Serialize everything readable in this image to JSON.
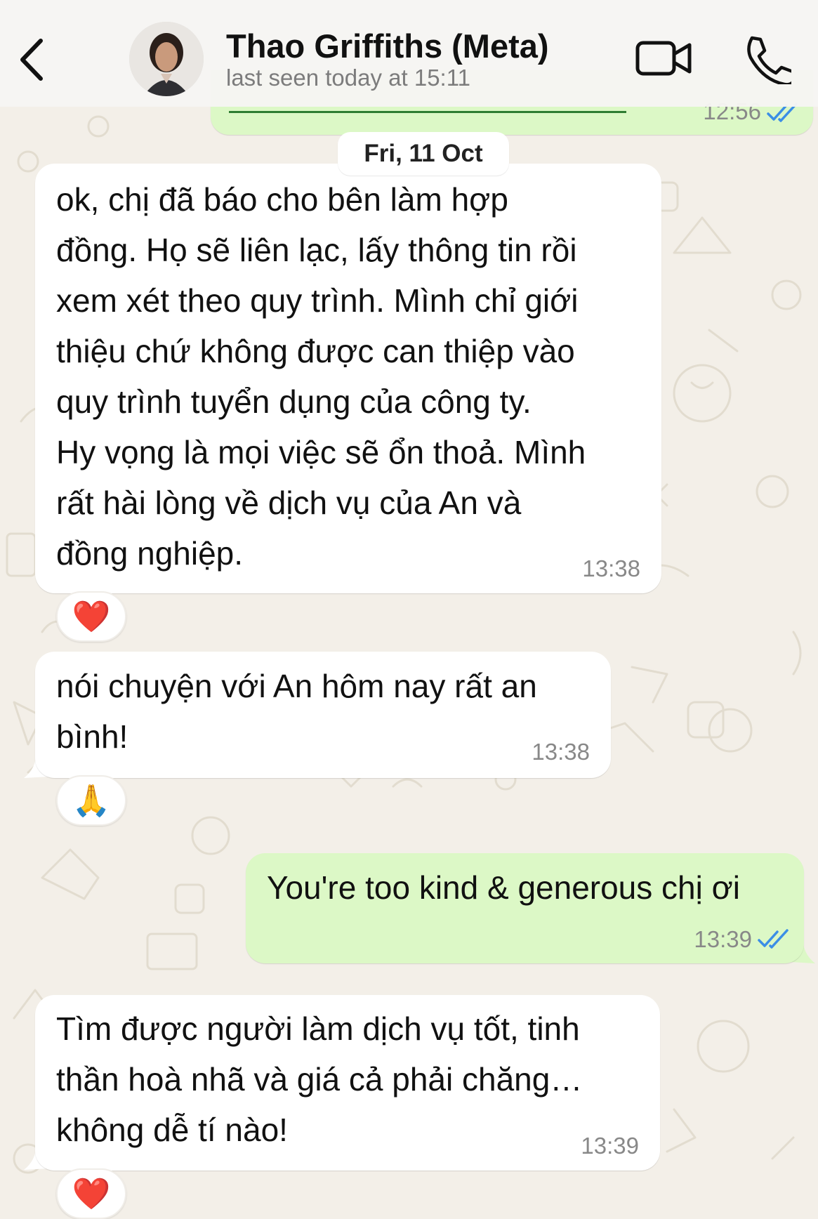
{
  "contact": {
    "name": "Thao Griffiths (Meta)",
    "status": "last seen today at 15:11"
  },
  "previous_message": {
    "time": "12:56"
  },
  "date_separator": "Fri, 11 Oct",
  "messages": [
    {
      "direction": "incoming",
      "lines": [
        "ok, chị đã báo cho bên làm hợp",
        "đồng. Họ sẽ liên lạc, lấy thông tin rồi",
        "xem xét theo quy trình. Mình chỉ giới",
        "thiệu chứ không được can thiệp vào",
        "quy trình tuyển dụng của công ty.",
        "Hy vọng là mọi việc sẽ ổn thoả. Mình",
        "rất hài lòng về dịch vụ của An và",
        "đồng nghiệp."
      ],
      "time": "13:38",
      "reaction": "❤️"
    },
    {
      "direction": "incoming",
      "lines": [
        "nói chuyện với An hôm nay rất an",
        "bình!"
      ],
      "time": "13:38",
      "reaction": "🙏"
    },
    {
      "direction": "outgoing",
      "lines": [
        "You're too kind & generous chị ơi"
      ],
      "time": "13:39",
      "status": "read"
    },
    {
      "direction": "incoming",
      "lines": [
        "Tìm được người làm dịch vụ tốt, tinh",
        "thần hoà nhã và giá cả phải chăng…",
        "không dễ tí nào!"
      ],
      "time": "13:39",
      "reaction": "❤️"
    }
  ],
  "colors": {
    "incoming_bubble": "#ffffff",
    "outgoing_bubble": "#dcf8c6",
    "read_ticks": "#3b8ee6",
    "wallpaper": "#f3efe8"
  },
  "icons": [
    "back-chevron-icon",
    "video-call-icon",
    "phone-call-icon",
    "read-receipt-icon"
  ]
}
